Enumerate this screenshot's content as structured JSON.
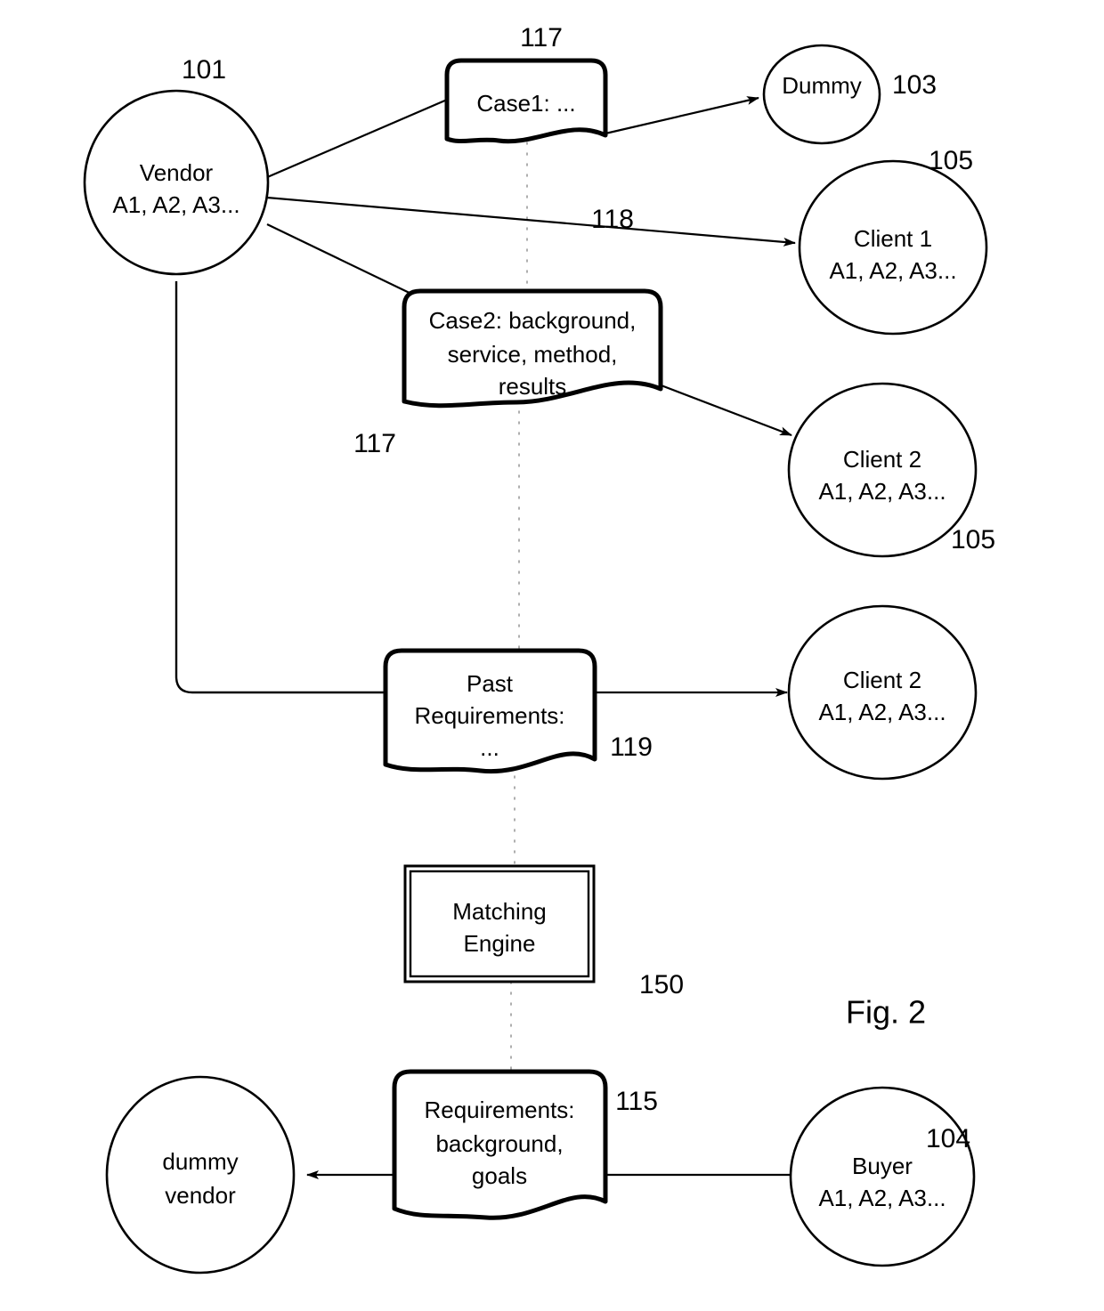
{
  "figure": {
    "caption": "Fig. 2"
  },
  "nodes": [
    {
      "id": "vendor",
      "kind": "circle",
      "lines": [
        "Vendor",
        "A1, A2, A3..."
      ],
      "ref": "101"
    },
    {
      "id": "dummy",
      "kind": "circle",
      "lines": [
        "Dummy"
      ],
      "ref": "103"
    },
    {
      "id": "client1",
      "kind": "circle",
      "lines": [
        "Client 1",
        "A1, A2, A3..."
      ],
      "ref": "105"
    },
    {
      "id": "client2-upper",
      "kind": "circle",
      "lines": [
        "Client 2",
        "A1, A2, A3..."
      ],
      "ref": "105"
    },
    {
      "id": "client2-lower",
      "kind": "circle",
      "lines": [
        "Client 2",
        "A1, A2, A3..."
      ],
      "ref": ""
    },
    {
      "id": "dummy-vendor",
      "kind": "circle",
      "lines": [
        "dummy",
        "vendor"
      ],
      "ref": ""
    },
    {
      "id": "buyer",
      "kind": "circle",
      "lines": [
        "Buyer",
        "A1, A2, A3..."
      ],
      "ref": "104"
    }
  ],
  "documents": [
    {
      "id": "case1",
      "lines": [
        "Case1: ..."
      ],
      "ref": "117"
    },
    {
      "id": "case2",
      "lines": [
        "Case2: background,",
        "service, method,",
        "results"
      ],
      "ref": "117"
    },
    {
      "id": "past-requirements",
      "lines": [
        "Past",
        "Requirements:",
        "..."
      ],
      "ref": "119"
    },
    {
      "id": "requirements",
      "lines": [
        "Requirements:",
        "background,",
        "goals"
      ],
      "ref": "115"
    }
  ],
  "engine": {
    "id": "matching-engine",
    "lines": [
      "Matching",
      "Engine"
    ],
    "ref": "150"
  },
  "edge_labels": {
    "vendor_to_client1": "118"
  },
  "colors": {
    "stroke": "#000000",
    "fill": "#ffffff",
    "dotted": "#9a9a9a"
  }
}
